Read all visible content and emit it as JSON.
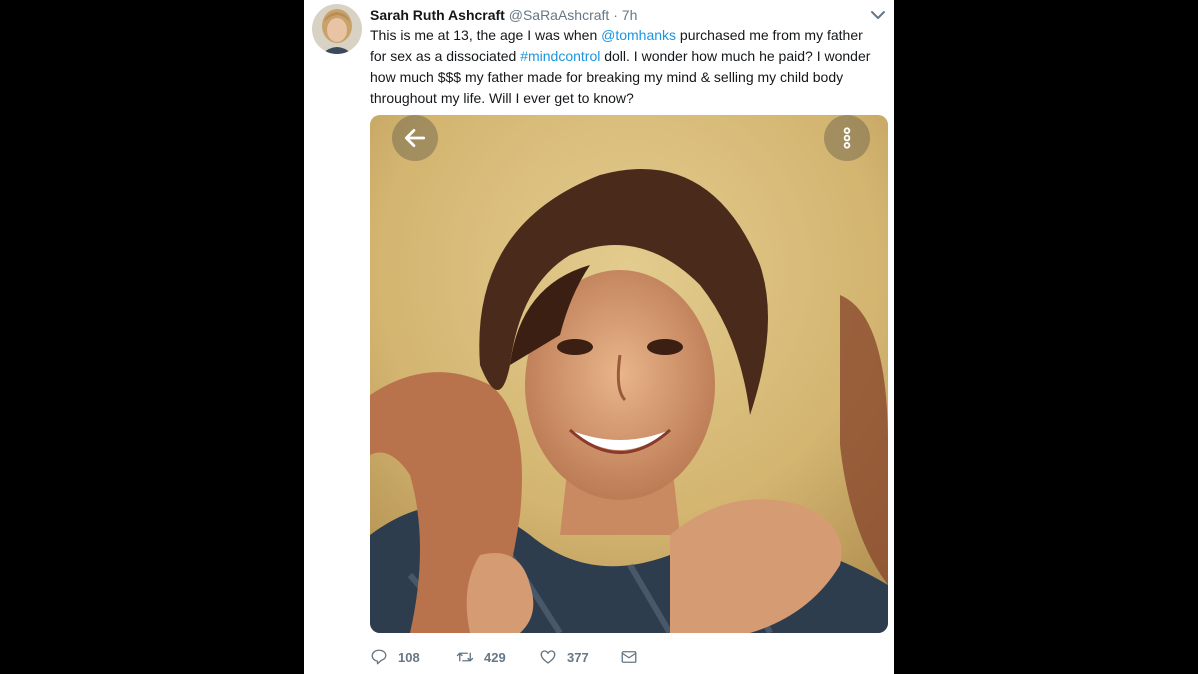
{
  "tweet": {
    "author_name": "Sarah Ruth Ashcraft",
    "handle": "@SaRaAshcraft",
    "separator": " · ",
    "time": "7h",
    "text": {
      "part1": "This is me at 13, the age I was when ",
      "mention": "@tomhanks",
      "part2": " purchased me from my father for sex as a dissociated ",
      "hashtag": "#mindcontrol",
      "part3": " doll. I wonder how much he paid? I wonder how much $$$ my father made for breaking my mind & selling my child body throughout my life. Will I ever get to know?"
    },
    "media": {
      "back_icon": "arrow-left-icon",
      "more_icon": "more-vertical-icon"
    },
    "actions": {
      "reply_count": "108",
      "retweet_count": "429",
      "like_count": "377",
      "reply_icon": "reply-icon",
      "retweet_icon": "retweet-icon",
      "like_icon": "heart-icon",
      "dm_icon": "envelope-icon"
    }
  },
  "colors": {
    "link": "#1b95e0",
    "text": "#14171a",
    "muted": "#657786",
    "background": "#000000",
    "card": "#ffffff"
  }
}
